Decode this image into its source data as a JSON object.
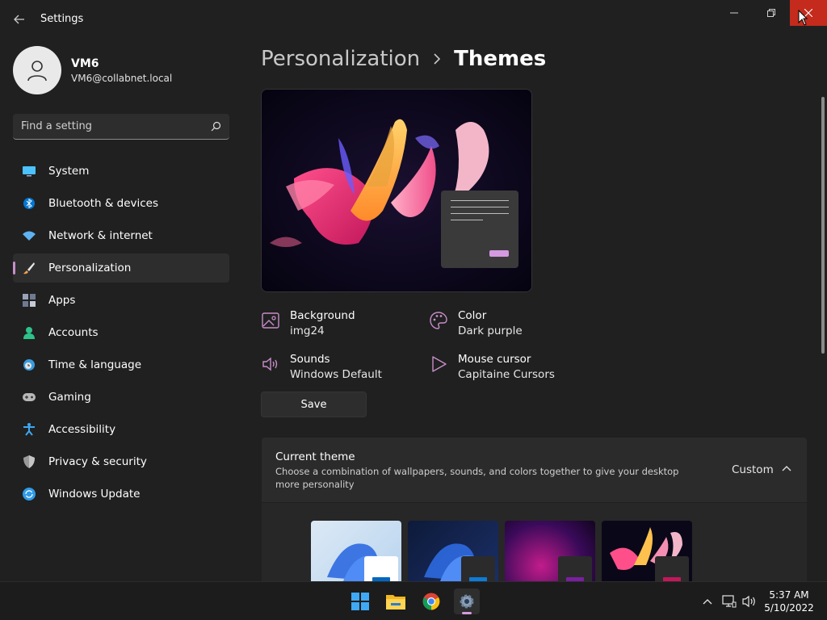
{
  "window": {
    "title": "Settings",
    "back_icon": "arrow-left-icon",
    "minimize_icon": "minimize-icon",
    "restore_icon": "restore-icon",
    "close_icon": "close-icon"
  },
  "profile": {
    "name": "VM6",
    "email": "VM6@collabnet.local"
  },
  "search": {
    "placeholder": "Find a setting",
    "icon": "search-icon"
  },
  "sidebar": {
    "items": [
      {
        "label": "System",
        "icon": "system-icon",
        "color": "#4cc2ff"
      },
      {
        "label": "Bluetooth & devices",
        "icon": "bluetooth-icon",
        "color": "#0078d4"
      },
      {
        "label": "Network & internet",
        "icon": "wifi-icon",
        "color": "#5fb2f2"
      },
      {
        "label": "Personalization",
        "icon": "brush-icon",
        "color": "#f0a050",
        "active": true
      },
      {
        "label": "Apps",
        "icon": "apps-icon",
        "color": "#9aa3b5"
      },
      {
        "label": "Accounts",
        "icon": "accounts-icon",
        "color": "#2ec28b"
      },
      {
        "label": "Time & language",
        "icon": "clock-globe-icon",
        "color": "#3a9be0"
      },
      {
        "label": "Gaming",
        "icon": "gamepad-icon",
        "color": "#b8b8b8"
      },
      {
        "label": "Accessibility",
        "icon": "accessibility-icon",
        "color": "#3da8f5"
      },
      {
        "label": "Privacy & security",
        "icon": "shield-icon",
        "color": "#9a9a9a"
      },
      {
        "label": "Windows Update",
        "icon": "update-icon",
        "color": "#2f9be8"
      }
    ]
  },
  "breadcrumb": {
    "parent": "Personalization",
    "current": "Themes"
  },
  "theme_props": {
    "background": {
      "label": "Background",
      "value": "img24"
    },
    "color": {
      "label": "Color",
      "value": "Dark purple"
    },
    "sounds": {
      "label": "Sounds",
      "value": "Windows Default"
    },
    "cursor": {
      "label": "Mouse cursor",
      "value": "Capitaine Cursors"
    }
  },
  "save_label": "Save",
  "current_theme": {
    "title": "Current theme",
    "description": "Choose a combination of wallpapers, sounds, and colors together to give your desktop more personality",
    "value": "Custom"
  },
  "accent_color": "#d49ae0",
  "taskbar": {
    "apps": [
      "windows-start-icon",
      "file-explorer-icon",
      "chrome-icon",
      "settings-gear-icon"
    ],
    "time": "5:37 AM",
    "date": "5/10/2022"
  }
}
